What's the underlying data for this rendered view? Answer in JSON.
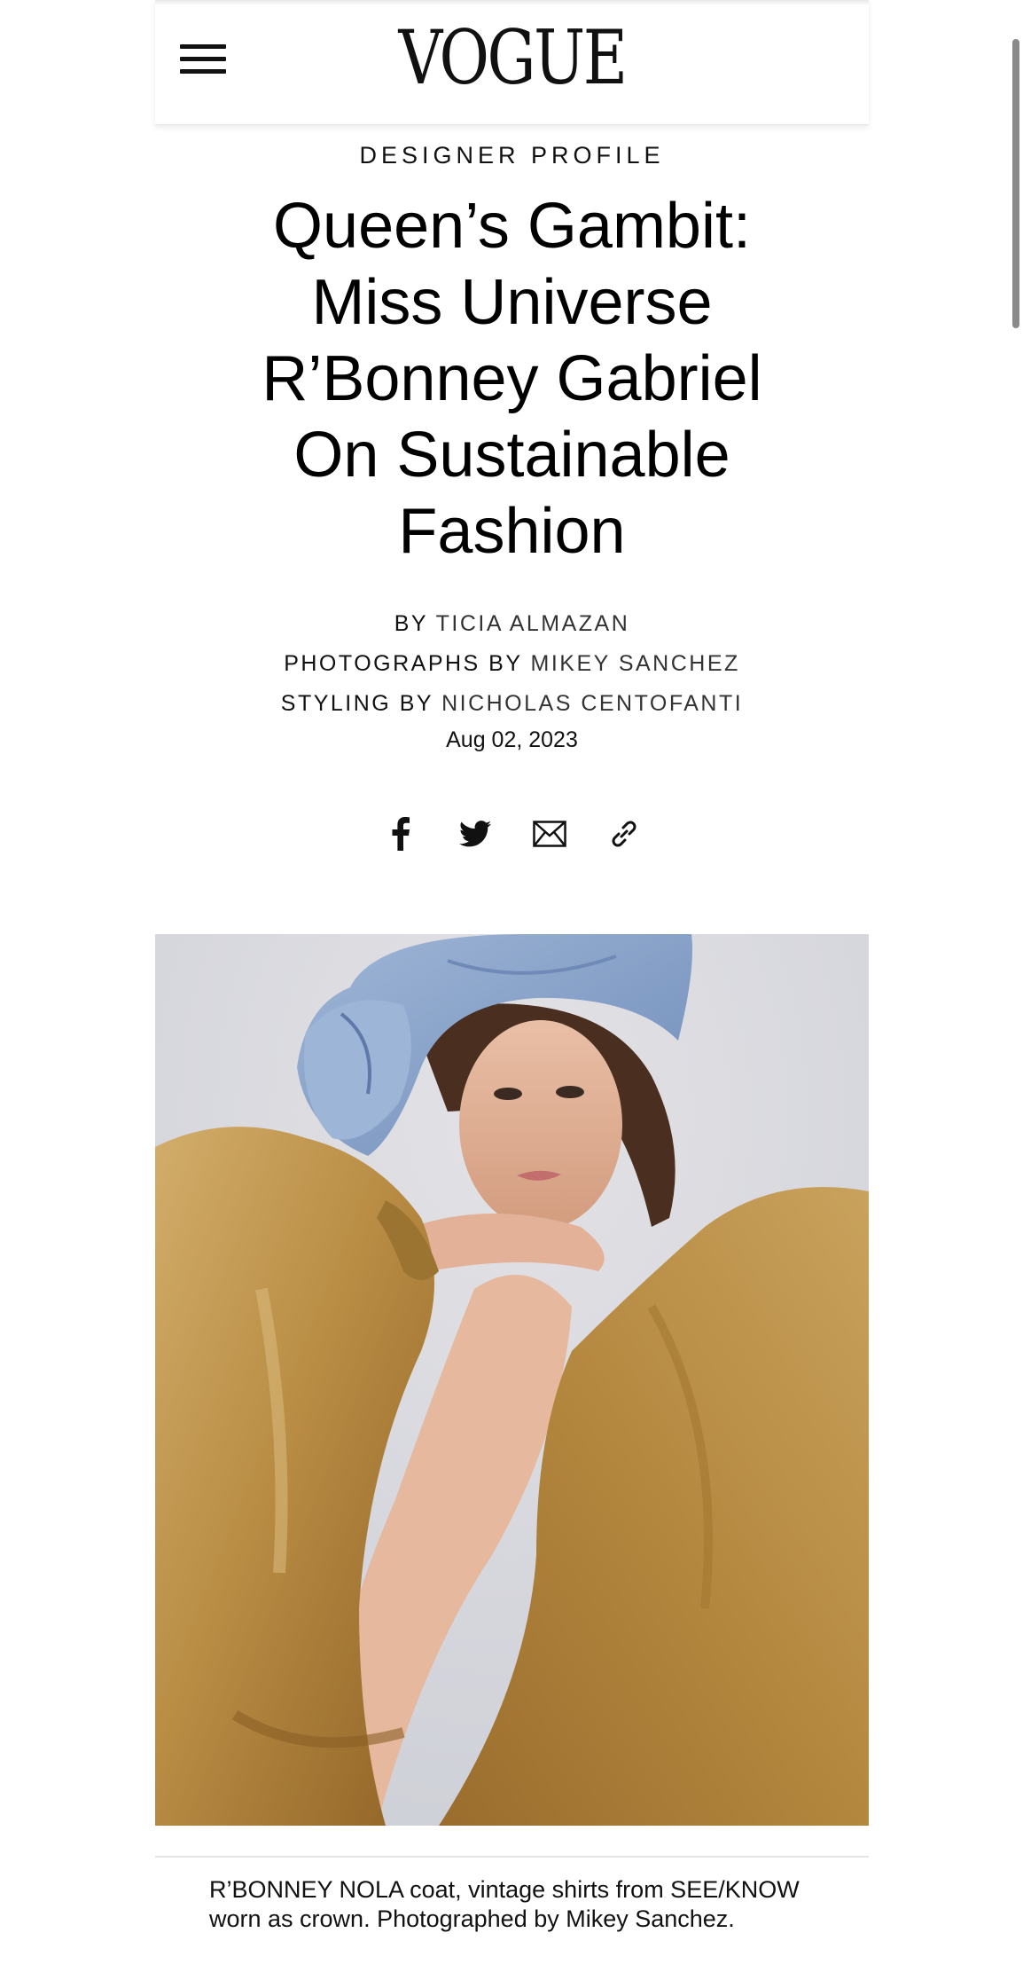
{
  "header": {
    "logo": "VOGUE",
    "menu_icon": "hamburger-menu-icon"
  },
  "article": {
    "kicker": "DESIGNER PROFILE",
    "headline_lines": [
      "Queen’s Gambit:",
      "Miss Universe",
      "R’Bonney Gabriel",
      "On Sustainable",
      "Fashion"
    ],
    "credits": [
      {
        "role": "BY",
        "name": "TICIA ALMAZAN"
      },
      {
        "role": "PHOTOGRAPHS BY",
        "name": "MIKEY SANCHEZ"
      },
      {
        "role": "STYLING BY",
        "name": "NICHOLAS CENTOFANTI"
      }
    ],
    "date": "Aug 02, 2023"
  },
  "share": {
    "icons": [
      "facebook-icon",
      "twitter-icon",
      "email-icon",
      "link-icon"
    ]
  },
  "hero": {
    "caption": "R’BONNEY NOLA coat, vintage shirts from SEE/KNOW worn as crown. Photographed by Mikey Sanchez."
  },
  "colors": {
    "coat_gold": "#b98d44",
    "denim_blue": "#7f9cc6",
    "background_gray": "#dcdde2"
  }
}
